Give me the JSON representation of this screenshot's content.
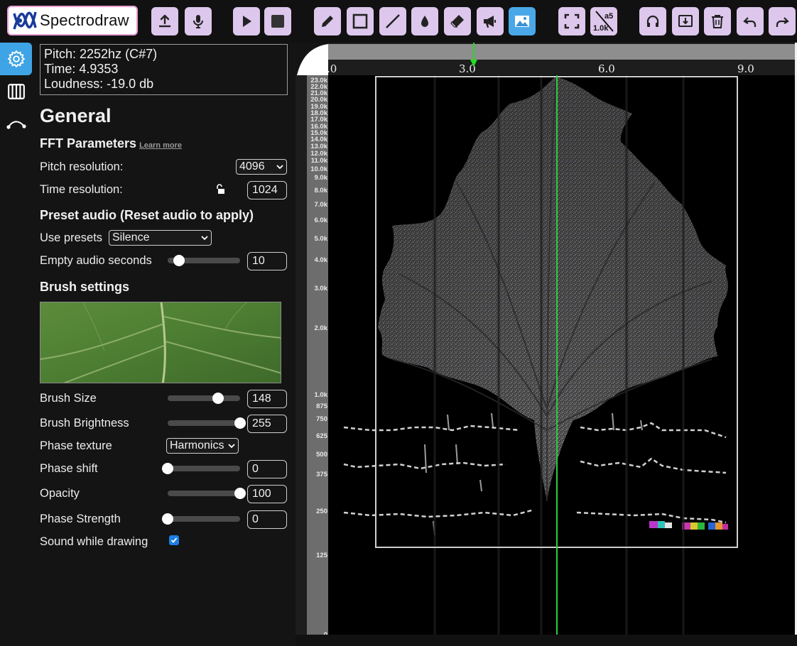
{
  "app": {
    "name": "Spectrodraw"
  },
  "toolbar": {
    "buttons": [
      {
        "name": "upload-button",
        "icon": "upload-icon"
      },
      {
        "name": "record-button",
        "icon": "microphone-icon"
      },
      {
        "name": "play-button",
        "icon": "play-icon"
      },
      {
        "name": "stop-button",
        "icon": "stop-icon"
      },
      {
        "name": "pencil-tool-button",
        "icon": "pencil-icon"
      },
      {
        "name": "rectangle-tool-button",
        "icon": "rectangle-icon"
      },
      {
        "name": "line-tool-button",
        "icon": "line-icon"
      },
      {
        "name": "blur-tool-button",
        "icon": "droplet-icon"
      },
      {
        "name": "eraser-tool-button",
        "icon": "eraser-icon"
      },
      {
        "name": "amplify-tool-button",
        "icon": "megaphone-icon"
      },
      {
        "name": "image-tool-button",
        "icon": "image-icon",
        "active": true
      },
      {
        "name": "fullscreen-button",
        "icon": "fullscreen-icon"
      },
      {
        "name": "note-scale-toggle-button",
        "icon": "note-scale-icon",
        "top_text": "a5",
        "bottom_text": "1.0k"
      },
      {
        "name": "listen-button",
        "icon": "headphones-icon"
      },
      {
        "name": "export-image-button",
        "icon": "export-image-icon"
      },
      {
        "name": "clear-button",
        "icon": "trash-icon"
      },
      {
        "name": "undo-button",
        "icon": "undo-icon"
      },
      {
        "name": "redo-button",
        "icon": "redo-icon"
      }
    ]
  },
  "rail": {
    "items": [
      {
        "name": "settings-tab",
        "icon": "gear-icon",
        "active": true
      },
      {
        "name": "piano-tab",
        "icon": "piano-icon"
      },
      {
        "name": "curve-tab",
        "icon": "curve-icon"
      }
    ]
  },
  "readout": {
    "pitch": "Pitch: 2252hz (C#7)",
    "time": "Time: 4.9353",
    "loudness": "Loudness: -19.0 db"
  },
  "general": {
    "title": "General",
    "fft": {
      "heading": "FFT Parameters",
      "learn_more": "Learn more",
      "pitch_resolution_label": "Pitch resolution:",
      "pitch_resolution_value": "4096",
      "time_resolution_label": "Time resolution:",
      "time_resolution_value": "1024"
    },
    "preset": {
      "heading": "Preset audio (Reset audio to apply)",
      "use_presets_label": "Use presets",
      "use_presets_value": "Silence",
      "empty_seconds_label": "Empty audio seconds",
      "empty_seconds_value": "10",
      "empty_seconds_slider": 0.16
    },
    "brush": {
      "heading": "Brush settings",
      "size_label": "Brush Size",
      "size_value": "148",
      "size_slider": 0.7,
      "brightness_label": "Brush Brightness",
      "brightness_value": "255",
      "brightness_slider": 1.0,
      "phase_texture_label": "Phase texture",
      "phase_texture_value": "Harmonics",
      "phase_shift_label": "Phase shift",
      "phase_shift_value": "0",
      "phase_shift_slider": 0.0,
      "opacity_label": "Opacity",
      "opacity_value": "100",
      "opacity_slider": 1.0,
      "phase_strength_label": "Phase Strength",
      "phase_strength_value": "0",
      "phase_strength_slider": 0.0,
      "sound_while_drawing_label": "Sound while drawing",
      "sound_while_drawing_checked": true
    }
  },
  "spectrogram": {
    "time_ticks": [
      ".0",
      "3.0",
      "6.0",
      "9.0"
    ],
    "freq_ticks": [
      "23.0k",
      "22.0k",
      "21.0k",
      "20.0k",
      "19.0k",
      "18.0k",
      "17.0k",
      "16.0k",
      "15.0k",
      "14.0k",
      "13.0k",
      "12.0k",
      "11.0k",
      "10.0k",
      "9.0k",
      "8.0k",
      "7.0k",
      "6.0k",
      "5.0k",
      "4.0k",
      "3.0k",
      "2.0k",
      "1.0k",
      "875",
      "750",
      "625",
      "500",
      "375",
      "250",
      "125",
      "0"
    ],
    "playhead_time": 4.9353,
    "colors": {
      "playhead": "#2ecc40",
      "marker": "#22dd22"
    }
  }
}
